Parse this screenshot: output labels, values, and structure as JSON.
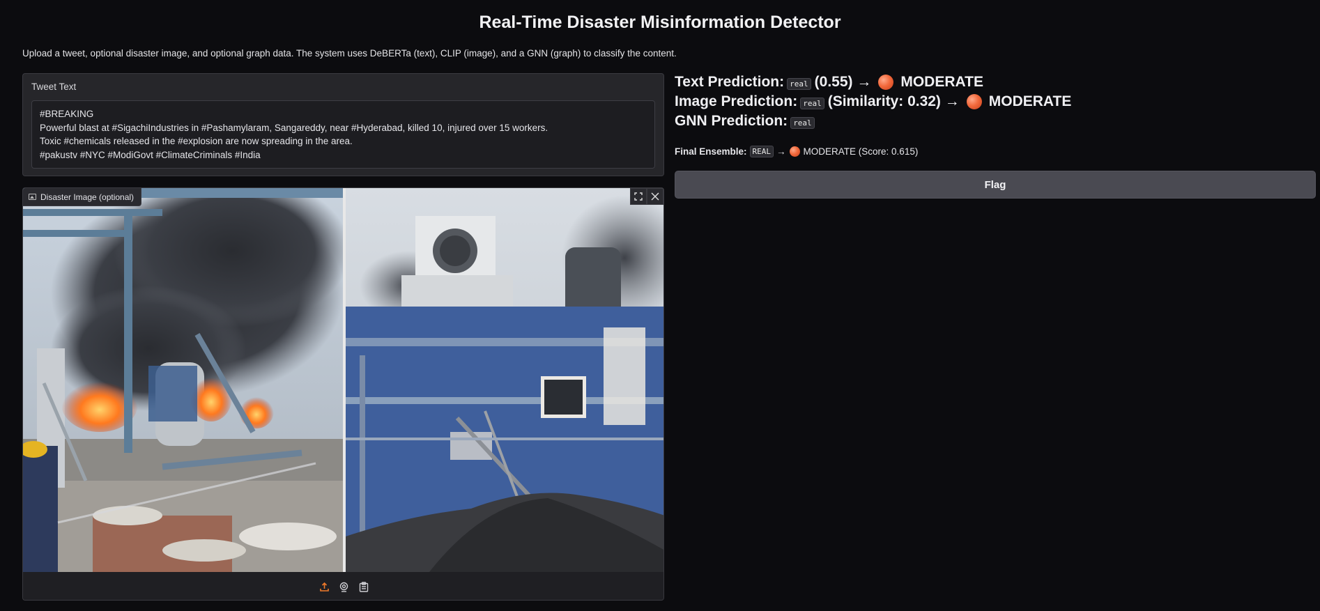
{
  "page": {
    "title": "Real-Time Disaster Misinformation Detector",
    "description": "Upload a tweet, optional disaster image, and optional graph data. The system uses DeBERTa (text), CLIP (image), and a GNN (graph) to classify the content."
  },
  "tweet": {
    "label": "Tweet Text",
    "lines": [
      "#BREAKING",
      "Powerful blast at #SigachiIndustries in #Pashamylaram, Sangareddy, near #Hyderabad, killed 10, injured over 15 workers.",
      "Toxic #chemicals released in the #explosion are now spreading in the area.",
      "#pakustv #NYC #ModiGovt #ClimateCriminals #India"
    ]
  },
  "image": {
    "label": "Disaster Image (optional)",
    "icons": [
      "fullscreen-icon",
      "close-icon",
      "upload-icon",
      "webcam-icon",
      "clipboard-icon"
    ]
  },
  "results": {
    "text_prefix": "Text Prediction:",
    "text_code": "real",
    "text_score": "(0.55) →",
    "text_level": "MODERATE",
    "image_prefix": "Image Prediction:",
    "image_code": "real",
    "image_score": "(Similarity: 0.32) →",
    "image_level": "MODERATE",
    "gnn_prefix": "GNN Prediction:",
    "gnn_code": "real",
    "final_prefix": "Final Ensemble:",
    "final_code": "REAL",
    "final_arrow": "→",
    "final_text": "MODERATE (Score: 0.615)"
  },
  "actions": {
    "flag_label": "Flag"
  },
  "colors": {
    "background": "#0c0c0f",
    "panel": "#26262a",
    "button": "#4a4a52",
    "orb": "#f26a3d",
    "upload_icon": "#f07a2a"
  }
}
